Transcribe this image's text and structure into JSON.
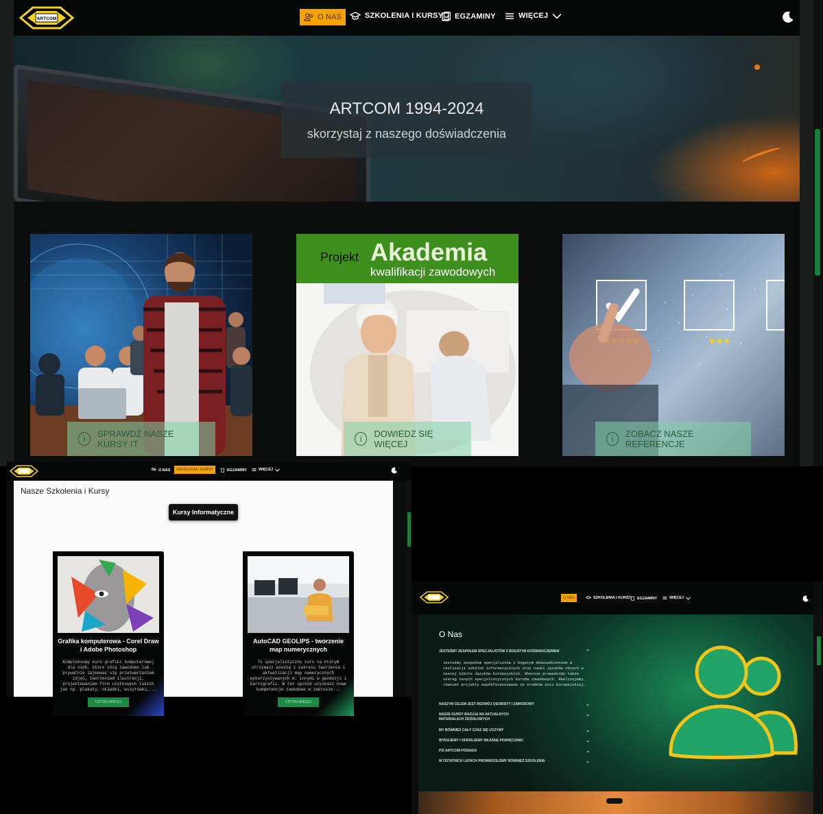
{
  "nav": {
    "about": "O NAS",
    "courses": "SZKOLENIA I KURSY",
    "exams": "EGZAMINY",
    "more": "WIĘCEJ",
    "logo_text": "ARTCOM"
  },
  "hero": {
    "title": "ARTCOM 1994-2024",
    "subtitle": "skorzystaj z naszego doświadczenia"
  },
  "cards": [
    {
      "button": "SPRAWDŹ NASZE KURSY IT"
    },
    {
      "banner_prefix": "Projekt",
      "banner_title": "Akademia",
      "banner_sub": "kwalifikacji zawodowych",
      "button": "DOWIEDZ SIĘ WIĘCEJ"
    },
    {
      "button": "ZOBACZ NASZE REFERENCJE"
    }
  ],
  "courses_page": {
    "title": "Nasze Szkolenia i Kursy",
    "category": "Kursy Informatyczne",
    "items": [
      {
        "title": "Grafika komputerowa - Corel Draw i Adobe Photoshop",
        "desc": "Kompleksowy kurs grafiki komputerowej dla osób, które chcą zawodowo lub prywatnie zajmować się przetwarzaniem zdjęć, tworzeniem ilustracji, projektowaniem form użytkowych takich jak np. plakaty, okładki, wizytówki,...",
        "button": "CZYTAJ WIĘCEJ"
      },
      {
        "title": "AutoCAD GEOLIPS - tworzenie map numerycznych",
        "desc": "To specjalistyczny kurs na którym otrzymasz wiedzę z zakresu tworzenia i aktualizacji map numerycznych wykorzystywanych m. innymi w geodezji i kartografii. W ten sposób uzyskasz nowe kompetencje zawodowe w zakresie...",
        "button": "CZYTAJ WIĘCEJ"
      }
    ]
  },
  "about_page": {
    "title": "O Nas",
    "open_heading": "JESTEŚMY ZESPOŁEM SPECJALISTÓW Z BOGATYM DOŚWIADCZENIEM",
    "open_body": "Jesteśmy zespołem specjalistów z bogatym doświadczeniem w realizacji szkoleń informatycznych oraz nauki języków obcych w naszej Szkole Języków Europejskich. Obecnie prowadzimy także szereg innych specjalistycznych kursów zawodowych. Realizujemy również projekty współfinansowane ze środków Unii Europejskiej.",
    "items": [
      "NASZYM CELEM JEST ROZWÓJ OSOBISTY I ZAWODOWY",
      "NASZE KURSY BAZUJĄ NA AKTUALNYCH MATERIAŁACH ŹRÓDŁOWYCH",
      "MY RÓWNIEŻ CAŁY CZAS SIĘ UCZYMY",
      "WYDAJEMY I OFERUJEMY WŁASNE PODRĘCZNIKI",
      "PZI ARTCOM POSIADA",
      "W OSTATNICH LATACH PROWADZILIŚMY RÓWNIEŻ SZKOLENIA"
    ]
  },
  "colors": {
    "accent": "#f5a300",
    "brand_green": "#1c8a45",
    "logo_yellow": "#f2d21b"
  },
  "icons": [
    "users-icon",
    "graduation-cap-icon",
    "exam-icon",
    "menu-icon",
    "chevron-down-icon",
    "moon-icon",
    "info-icon",
    "team-icon"
  ]
}
